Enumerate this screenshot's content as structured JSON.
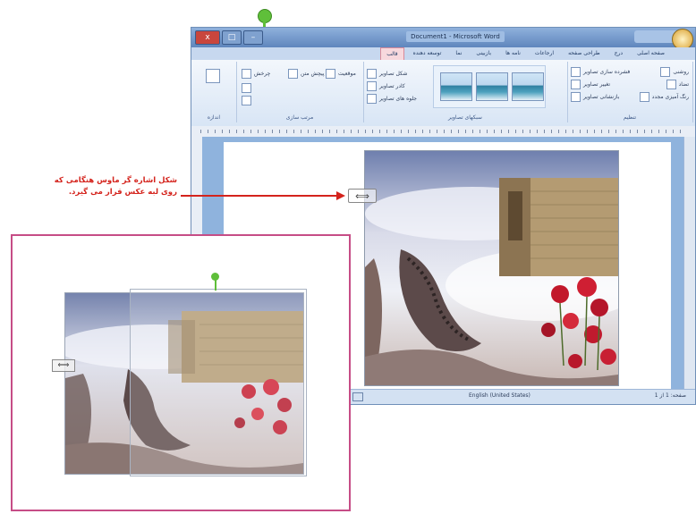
{
  "window": {
    "title": "Document1 - Microsoft Word",
    "buttons": {
      "close": "x",
      "maximize": "□",
      "minimize": "–"
    }
  },
  "tabs": [
    "صفحه اصلی",
    "درج",
    "طراحی صفحه",
    "ارجاعات",
    "نامه ها",
    "بازبینی",
    "نما",
    "توسعه دهنده",
    "قالب"
  ],
  "active_tab": "قالب",
  "ribbon": {
    "adjust": [
      "روشنی",
      "تضاد",
      "رنگ آمیزی مجدد"
    ],
    "adjust_right": [
      "فشرده سازی تصاویر",
      "تغییر تصاویر",
      "بازنشانی تصاویر"
    ],
    "adjust_label": "تنظیم",
    "styles_label": "سبکهای تصاویر",
    "styles_options": [
      "شکل تصاویر",
      "کادر تصاویر",
      "جلوه های تصاویر"
    ],
    "arrange": [
      "موقعیت",
      "پیچش متن",
      "چرخش"
    ],
    "arrange_label": "مرتب سازی",
    "size_label": "اندازه"
  },
  "status": {
    "language": "English (United States)",
    "page": "صفحه: 1 از 1"
  },
  "annotation": {
    "line1": "شکل اشاره گر ماوس هنگامی که",
    "line2": "روی لبه عکس قرار می گیرد."
  },
  "colors": {
    "accent_red": "#d4231c",
    "zoom_border": "#c64d86",
    "rotation_handle": "#5fbf3a"
  },
  "icons": {
    "resize_cursor": "⟺"
  }
}
